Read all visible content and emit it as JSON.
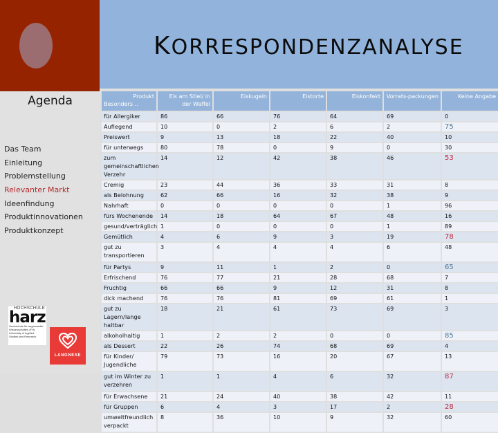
{
  "slide": {
    "title_first": "K",
    "title_rest": "ORRESPONDENZANALYSE"
  },
  "sidebar": {
    "heading": "Agenda",
    "items": [
      {
        "label": "Das Team",
        "active": false
      },
      {
        "label": "Einleitung",
        "active": false
      },
      {
        "label": "Problemstellung",
        "active": false
      },
      {
        "label": "Relevanter Markt",
        "active": true
      },
      {
        "label": "Ideenfindung",
        "active": false
      },
      {
        "label": "Produktinnovationen",
        "active": false
      },
      {
        "label": "Produktkonzept",
        "active": false
      }
    ],
    "logos": {
      "harz_top": "HOCHSCHULE",
      "harz_word": "harz",
      "harz_line1": "Hochschule für angewandte",
      "harz_line2": "Wissenschaften (FH)",
      "harz_line3": "University of Applied",
      "harz_line4": "Studies and Research",
      "langnese": "LANGNESE"
    },
    "colors": {
      "active": "#b52a2a",
      "accent_red": "#952300",
      "header_blue": "#92b4dc"
    }
  },
  "table": {
    "corner_top": "Produkt",
    "corner_bottom": "Besonders ..",
    "columns": [
      "Eis am Stiel/ in der Waffel",
      "Eiskugeln",
      "Eistorte",
      "Eiskonfekt",
      "Vorrats-packungen",
      "Keine Angabe"
    ],
    "rows": [
      {
        "label": "für Allergiker",
        "values": [
          "86",
          "66",
          "76",
          "64",
          "69",
          "0"
        ],
        "hl": ""
      },
      {
        "label": "Auflegend",
        "values": [
          "10",
          "0",
          "2",
          "6",
          "2",
          "75"
        ],
        "hl": "blue"
      },
      {
        "label": "Preiswert",
        "values": [
          "9",
          "13",
          "18",
          "22",
          "40",
          "10"
        ],
        "hl": ""
      },
      {
        "label": "für unterwegs",
        "values": [
          "80",
          "78",
          "0",
          "9",
          "0",
          "30"
        ],
        "hl": ""
      },
      {
        "label": "zum gemeinschaftlichen Verzehr",
        "values": [
          "14",
          "12",
          "42",
          "38",
          "46",
          "53"
        ],
        "hl": "red",
        "tall": true
      },
      {
        "label": "Cremig",
        "values": [
          "23",
          "44",
          "36",
          "33",
          "31",
          "8"
        ],
        "hl": ""
      },
      {
        "label": "als Belohnung",
        "values": [
          "62",
          "66",
          "16",
          "32",
          "38",
          "9"
        ],
        "hl": ""
      },
      {
        "label": "Nahrhaft",
        "values": [
          "0",
          "0",
          "0",
          "0",
          "1",
          "96"
        ],
        "hl": ""
      },
      {
        "label": "fürs Wochenende",
        "values": [
          "14",
          "18",
          "64",
          "67",
          "48",
          "16"
        ],
        "hl": ""
      },
      {
        "label": "gesund/verträglich",
        "values": [
          "1",
          "0",
          "0",
          "0",
          "1",
          "89"
        ],
        "hl": ""
      },
      {
        "label": "Gemütlich",
        "values": [
          "4",
          "6",
          "9",
          "3",
          "19",
          "78"
        ],
        "hl": "red"
      },
      {
        "label": "gut zu transportieren",
        "values": [
          "3",
          "4",
          "4",
          "4",
          "6",
          "48"
        ],
        "hl": "",
        "tall": true
      },
      {
        "label": "für Partys",
        "values": [
          "9",
          "11",
          "1",
          "2",
          "0",
          "65"
        ],
        "hl": "blue"
      },
      {
        "label": "Erfrischend",
        "values": [
          "76",
          "77",
          "21",
          "28",
          "68",
          "7"
        ],
        "hl": ""
      },
      {
        "label": "Fruchtig",
        "values": [
          "66",
          "66",
          "9",
          "12",
          "31",
          "8"
        ],
        "hl": ""
      },
      {
        "label": "dick machend",
        "values": [
          "76",
          "76",
          "81",
          "69",
          "61",
          "1"
        ],
        "hl": ""
      },
      {
        "label": "gut zu Lagern/lange haltbar",
        "values": [
          "18",
          "21",
          "61",
          "73",
          "69",
          "3"
        ],
        "hl": "",
        "tall": true
      },
      {
        "label": "alkoholhaltig",
        "values": [
          "1",
          "2",
          "2",
          "0",
          "0",
          "85"
        ],
        "hl": "blue"
      },
      {
        "label": "als Dessert",
        "values": [
          "22",
          "26",
          "74",
          "68",
          "69",
          "4"
        ],
        "hl": ""
      },
      {
        "label": "für Kinder/ Jugendliche",
        "values": [
          "79",
          "73",
          "16",
          "20",
          "67",
          "13"
        ],
        "hl": "",
        "tall": true
      },
      {
        "label": "gut im Winter zu verzehren",
        "values": [
          "1",
          "1",
          "4",
          "6",
          "32",
          "87"
        ],
        "hl": "red",
        "tall": true
      },
      {
        "label": "für Erwachsene",
        "values": [
          "21",
          "24",
          "40",
          "38",
          "42",
          "11"
        ],
        "hl": ""
      },
      {
        "label": "für Gruppen",
        "values": [
          "6",
          "4",
          "3",
          "17",
          "2",
          "28"
        ],
        "hl": "red"
      },
      {
        "label": "umweltfreundlich verpackt",
        "values": [
          "8",
          "36",
          "10",
          "9",
          "32",
          "60"
        ],
        "hl": "",
        "tall": true
      }
    ]
  }
}
